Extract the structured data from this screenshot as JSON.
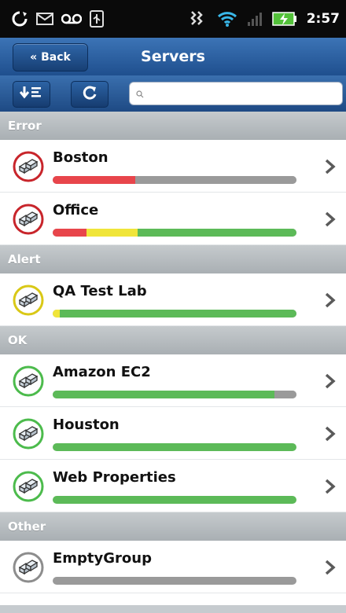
{
  "status_bar": {
    "time": "2:57",
    "icons": [
      "sync-icon",
      "mail-icon",
      "voicemail-icon",
      "usb-icon",
      "vibrate-icon",
      "wifi-icon",
      "signal-icon",
      "battery-charging-icon"
    ]
  },
  "header": {
    "back_label": "« Back",
    "title": "Servers"
  },
  "toolbar": {
    "sort_icon": "sort-descending-icon",
    "refresh_icon": "refresh-icon",
    "search_placeholder": ""
  },
  "colors": {
    "error": "#e8454b",
    "warning": "#f0e53a",
    "ok": "#5cba58",
    "unknown": "#9a9a9a",
    "ring_error": "#c8252b",
    "ring_alert": "#d9c816",
    "ring_ok": "#4cbb4c",
    "ring_other": "#8d8d8d"
  },
  "sections": [
    {
      "title": "Error",
      "rows": [
        {
          "name": "Boston",
          "status": "error",
          "bar": [
            {
              "c": "error",
              "v": 0.34
            },
            {
              "c": "unknown",
              "v": 0.66
            }
          ]
        },
        {
          "name": "Office",
          "status": "error",
          "bar": [
            {
              "c": "error",
              "v": 0.14
            },
            {
              "c": "warning",
              "v": 0.21
            },
            {
              "c": "ok",
              "v": 0.65
            }
          ]
        }
      ]
    },
    {
      "title": "Alert",
      "rows": [
        {
          "name": "QA Test Lab",
          "status": "alert",
          "bar": [
            {
              "c": "warning",
              "v": 0.03
            },
            {
              "c": "ok",
              "v": 0.97
            }
          ]
        }
      ]
    },
    {
      "title": "OK",
      "rows": [
        {
          "name": "Amazon EC2",
          "status": "ok",
          "bar": [
            {
              "c": "ok",
              "v": 0.91
            },
            {
              "c": "unknown",
              "v": 0.09
            }
          ]
        },
        {
          "name": "Houston",
          "status": "ok",
          "bar": [
            {
              "c": "ok",
              "v": 1.0
            }
          ]
        },
        {
          "name": "Web Properties",
          "status": "ok",
          "bar": [
            {
              "c": "ok",
              "v": 1.0
            }
          ]
        }
      ]
    },
    {
      "title": "Other",
      "rows": [
        {
          "name": "EmptyGroup",
          "status": "other",
          "bar": [
            {
              "c": "unknown",
              "v": 1.0
            }
          ]
        }
      ]
    }
  ]
}
